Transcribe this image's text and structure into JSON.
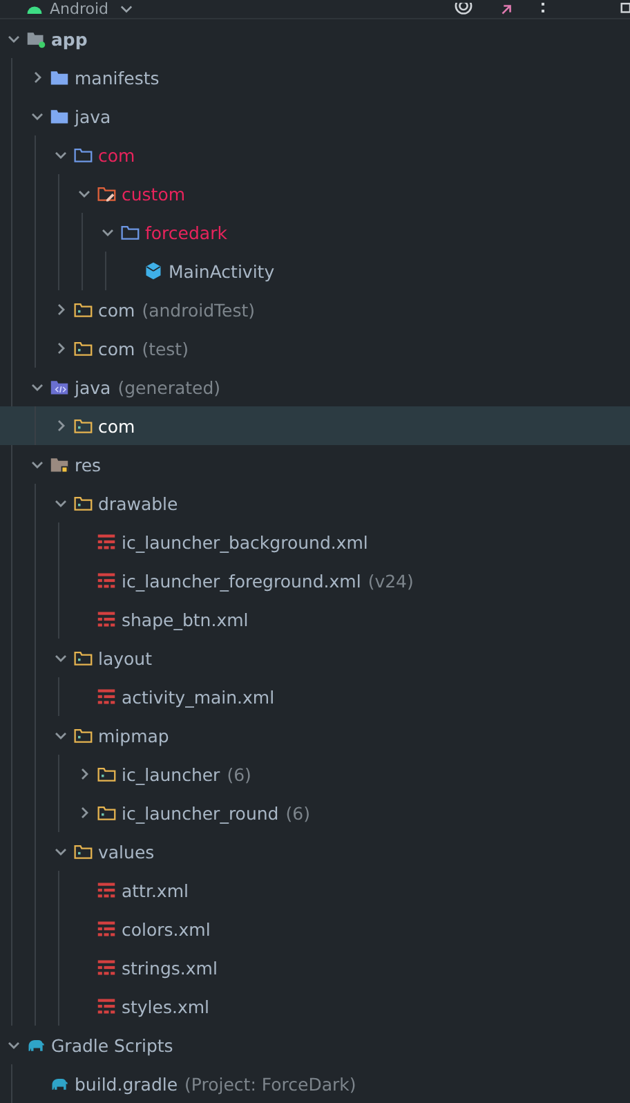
{
  "toolbar": {
    "view": "Android"
  },
  "tree": [
    {
      "name": "app",
      "kind": "module",
      "expanded": true,
      "selected": false,
      "children": [
        {
          "name": "manifests",
          "kind": "folder",
          "expanded": false,
          "selected": false
        },
        {
          "name": "java",
          "kind": "folder",
          "expanded": true,
          "selected": false,
          "children": [
            {
              "name": "com",
              "kind": "package",
              "color": "#e8245c",
              "expanded": true,
              "selected": false,
              "children": [
                {
                  "name": "custom",
                  "kind": "package-changed",
                  "color": "#e8245c",
                  "expanded": true,
                  "selected": false,
                  "children": [
                    {
                      "name": "forcedark",
                      "kind": "package",
                      "color": "#e8245c",
                      "expanded": true,
                      "selected": false,
                      "children": [
                        {
                          "name": "MainActivity",
                          "kind": "class",
                          "selected": false
                        }
                      ]
                    }
                  ]
                }
              ]
            },
            {
              "name": "com",
              "note": "(androidTest)",
              "kind": "test-package",
              "expanded": false,
              "selected": false
            },
            {
              "name": "com",
              "note": "(test)",
              "kind": "test-package",
              "expanded": false,
              "selected": false
            }
          ]
        },
        {
          "name": "java",
          "note": "(generated)",
          "kind": "generated",
          "expanded": true,
          "selected": false,
          "children": [
            {
              "name": "com",
              "kind": "test-package",
              "expanded": false,
              "selected": true
            }
          ]
        },
        {
          "name": "res",
          "kind": "res",
          "expanded": true,
          "selected": false,
          "children": [
            {
              "name": "drawable",
              "kind": "test-package",
              "expanded": true,
              "selected": false,
              "children": [
                {
                  "name": "ic_launcher_background.xml",
                  "kind": "xml",
                  "selected": false
                },
                {
                  "name": "ic_launcher_foreground.xml",
                  "note": "(v24)",
                  "kind": "xml",
                  "selected": false
                },
                {
                  "name": "shape_btn.xml",
                  "kind": "xml",
                  "selected": false
                }
              ]
            },
            {
              "name": "layout",
              "kind": "test-package",
              "expanded": true,
              "selected": false,
              "children": [
                {
                  "name": "activity_main.xml",
                  "kind": "xml",
                  "selected": false
                }
              ]
            },
            {
              "name": "mipmap",
              "kind": "test-package",
              "expanded": true,
              "selected": false,
              "children": [
                {
                  "name": "ic_launcher",
                  "note": "(6)",
                  "kind": "test-package",
                  "expanded": false,
                  "selected": false
                },
                {
                  "name": "ic_launcher_round",
                  "note": "(6)",
                  "kind": "test-package",
                  "expanded": false,
                  "selected": false
                }
              ]
            },
            {
              "name": "values",
              "kind": "test-package",
              "expanded": true,
              "selected": false,
              "children": [
                {
                  "name": "attr.xml",
                  "kind": "xml",
                  "selected": false
                },
                {
                  "name": "colors.xml",
                  "kind": "xml",
                  "selected": false
                },
                {
                  "name": "strings.xml",
                  "kind": "xml",
                  "selected": false
                },
                {
                  "name": "styles.xml",
                  "kind": "xml",
                  "selected": false
                }
              ]
            }
          ]
        }
      ]
    },
    {
      "name": "Gradle Scripts",
      "kind": "gradle",
      "expanded": true,
      "selected": false,
      "children": [
        {
          "name": "build.gradle",
          "note": "(Project: ForceDark)",
          "kind": "gradle",
          "selected": false
        }
      ]
    }
  ]
}
